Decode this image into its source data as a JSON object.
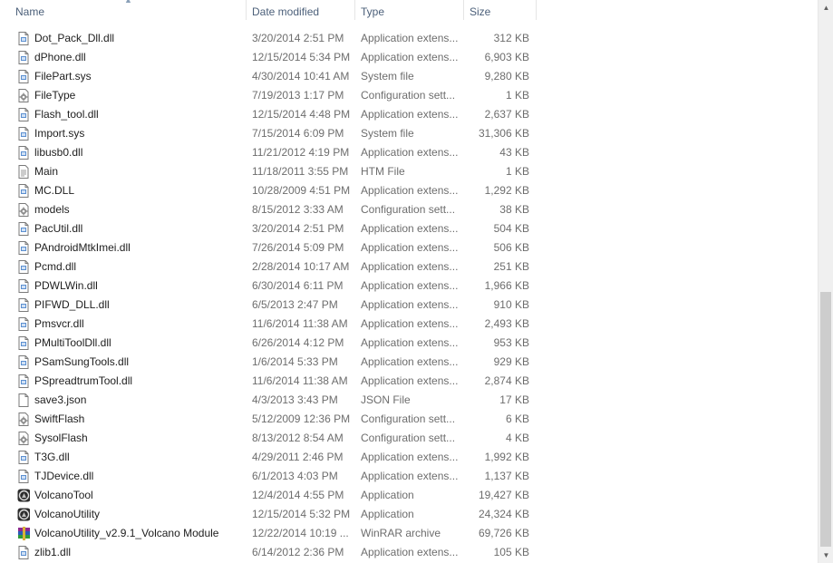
{
  "columns": {
    "name": "Name",
    "date": "Date modified",
    "type": "Type",
    "size": "Size"
  },
  "files": [
    {
      "name": "Dot_Pack_Dll.dll",
      "date": "3/20/2014 2:51 PM",
      "type": "Application extens...",
      "size": "312 KB",
      "icon": "dll-file-icon"
    },
    {
      "name": "dPhone.dll",
      "date": "12/15/2014 5:34 PM",
      "type": "Application extens...",
      "size": "6,903 KB",
      "icon": "dll-file-icon"
    },
    {
      "name": "FilePart.sys",
      "date": "4/30/2014 10:41 AM",
      "type": "System file",
      "size": "9,280 KB",
      "icon": "dll-file-icon"
    },
    {
      "name": "FileType",
      "date": "7/19/2013 1:17 PM",
      "type": "Configuration sett...",
      "size": "1 KB",
      "icon": "config-file-icon"
    },
    {
      "name": "Flash_tool.dll",
      "date": "12/15/2014 4:48 PM",
      "type": "Application extens...",
      "size": "2,637 KB",
      "icon": "dll-file-icon"
    },
    {
      "name": "Import.sys",
      "date": "7/15/2014 6:09 PM",
      "type": "System file",
      "size": "31,306 KB",
      "icon": "dll-file-icon"
    },
    {
      "name": "libusb0.dll",
      "date": "11/21/2012 4:19 PM",
      "type": "Application extens...",
      "size": "43 KB",
      "icon": "dll-file-icon"
    },
    {
      "name": "Main",
      "date": "11/18/2011 3:55 PM",
      "type": "HTM File",
      "size": "1 KB",
      "icon": "document-file-icon"
    },
    {
      "name": "MC.DLL",
      "date": "10/28/2009 4:51 PM",
      "type": "Application extens...",
      "size": "1,292 KB",
      "icon": "dll-file-icon"
    },
    {
      "name": "models",
      "date": "8/15/2012 3:33 AM",
      "type": "Configuration sett...",
      "size": "38 KB",
      "icon": "config-file-icon"
    },
    {
      "name": "PacUtil.dll",
      "date": "3/20/2014 2:51 PM",
      "type": "Application extens...",
      "size": "504 KB",
      "icon": "dll-file-icon"
    },
    {
      "name": "PAndroidMtkImei.dll",
      "date": "7/26/2014 5:09 PM",
      "type": "Application extens...",
      "size": "506 KB",
      "icon": "dll-file-icon"
    },
    {
      "name": "Pcmd.dll",
      "date": "2/28/2014 10:17 AM",
      "type": "Application extens...",
      "size": "251 KB",
      "icon": "dll-file-icon"
    },
    {
      "name": "PDWLWin.dll",
      "date": "6/30/2014 6:11 PM",
      "type": "Application extens...",
      "size": "1,966 KB",
      "icon": "dll-file-icon"
    },
    {
      "name": "PIFWD_DLL.dll",
      "date": "6/5/2013 2:47 PM",
      "type": "Application extens...",
      "size": "910 KB",
      "icon": "dll-file-icon"
    },
    {
      "name": "Pmsvcr.dll",
      "date": "11/6/2014 11:38 AM",
      "type": "Application extens...",
      "size": "2,493 KB",
      "icon": "dll-file-icon"
    },
    {
      "name": "PMultiToolDll.dll",
      "date": "6/26/2014 4:12 PM",
      "type": "Application extens...",
      "size": "953 KB",
      "icon": "dll-file-icon"
    },
    {
      "name": "PSamSungTools.dll",
      "date": "1/6/2014 5:33 PM",
      "type": "Application extens...",
      "size": "929 KB",
      "icon": "dll-file-icon"
    },
    {
      "name": "PSpreadtrumTool.dll",
      "date": "11/6/2014 11:38 AM",
      "type": "Application extens...",
      "size": "2,874 KB",
      "icon": "dll-file-icon"
    },
    {
      "name": "save3.json",
      "date": "4/3/2013 3:43 PM",
      "type": "JSON File",
      "size": "17 KB",
      "icon": "blank-file-icon"
    },
    {
      "name": "SwiftFlash",
      "date": "5/12/2009 12:36 PM",
      "type": "Configuration sett...",
      "size": "6 KB",
      "icon": "config-file-icon"
    },
    {
      "name": "SysolFlash",
      "date": "8/13/2012 8:54 AM",
      "type": "Configuration sett...",
      "size": "4 KB",
      "icon": "config-file-icon"
    },
    {
      "name": "T3G.dll",
      "date": "4/29/2011 2:46 PM",
      "type": "Application extens...",
      "size": "1,992 KB",
      "icon": "dll-file-icon"
    },
    {
      "name": "TJDevice.dll",
      "date": "6/1/2013 4:03 PM",
      "type": "Application extens...",
      "size": "1,137 KB",
      "icon": "dll-file-icon"
    },
    {
      "name": "VolcanoTool",
      "date": "12/4/2014 4:55 PM",
      "type": "Application",
      "size": "19,427 KB",
      "icon": "volcano-app-icon"
    },
    {
      "name": "VolcanoUtility",
      "date": "12/15/2014 5:32 PM",
      "type": "Application",
      "size": "24,324 KB",
      "icon": "volcano-app-icon"
    },
    {
      "name": "VolcanoUtility_v2.9.1_Volcano Module",
      "date": "12/22/2014 10:19 ...",
      "type": "WinRAR archive",
      "size": "69,726 KB",
      "icon": "winrar-archive-icon"
    },
    {
      "name": "zlib1.dll",
      "date": "6/14/2012 2:36 PM",
      "type": "Application extens...",
      "size": "105 KB",
      "icon": "dll-file-icon"
    }
  ],
  "colors": {
    "header_text": "#4c607a",
    "secondary_text": "#6d6d6d",
    "primary_text": "#1e1e1e",
    "scroll_thumb": "#cdcdcd"
  }
}
